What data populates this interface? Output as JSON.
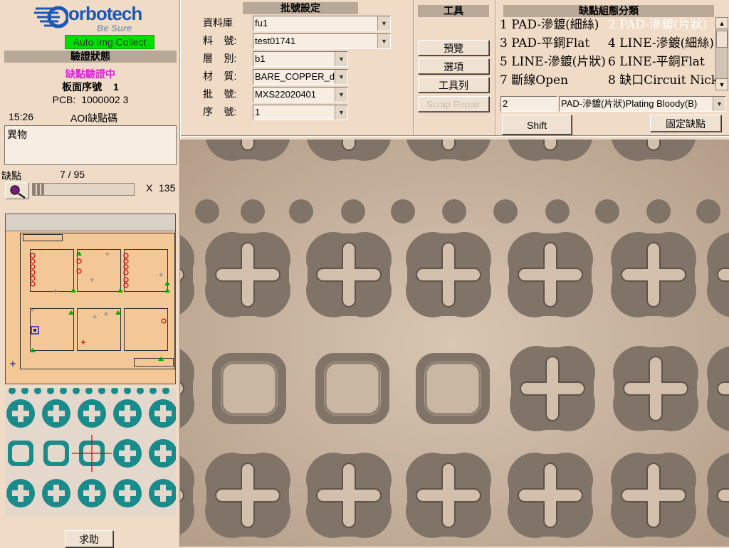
{
  "logo": {
    "brand": "orbotech",
    "tagline": "Be Sure"
  },
  "auto_img_collect": "Auto Img Collect",
  "verify_status": {
    "header": "驗證狀態",
    "state": "缺點驗證中",
    "board_seq_label": "板面序號",
    "board_seq_value": "1",
    "pcb_label": "PCB:",
    "pcb_value": "1000002 3",
    "time": "15:26",
    "aoi_label": "AOI缺點碼",
    "defect_text": "異物"
  },
  "defect_counter": {
    "label": "缺點",
    "current": "7 / 95",
    "x_label": "X",
    "x_value": "135",
    "progress": 0.07
  },
  "help_button": "求助",
  "batch": {
    "header": "批號設定",
    "fields": [
      {
        "label": "資料庫",
        "value": "fu1"
      },
      {
        "label": "料    號:",
        "value": "test01741"
      },
      {
        "label": "層    別:",
        "value": "b1"
      },
      {
        "label": "材    質:",
        "value": "BARE_COPPER_d"
      },
      {
        "label": "批    號:",
        "value": "MXS22020401"
      },
      {
        "label": "序    號:",
        "value": "1"
      }
    ]
  },
  "tools": {
    "header": "工具",
    "preview": "預覽",
    "options": "選項",
    "toolbar": "工具列",
    "scrap_repair": "Scrap Repair"
  },
  "defect_class": {
    "header": "缺點組態分類",
    "items": [
      "1 PAD-滲鍍(細絲)",
      "2 PAD-滲鍍(片狀)",
      "3 PAD-平銅Flat",
      "4 LINE-滲鍍(細絲)",
      "5 LINE-滲鍍(片狀)",
      "6 LINE-平銅Flat",
      "7 斷線Open",
      "8 缺口Circuit Nick"
    ],
    "selected_index": 1,
    "number_input": "2",
    "selected_name": "PAD-滲鍍(片狀)Plating Bloody(B)",
    "shift": "Shift",
    "fix_defect": "固定缺點"
  },
  "colors": {
    "bg": "#f0dbc6",
    "header": "#b7a898",
    "green": "#00e000",
    "magenta": "#e020e0",
    "teal": "#1a8b8b"
  }
}
